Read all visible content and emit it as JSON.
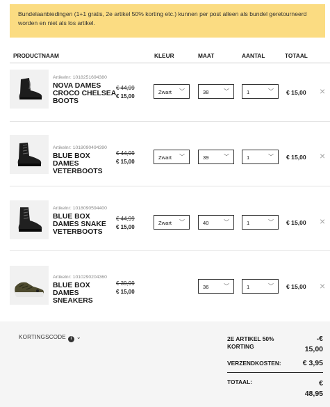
{
  "notice": {
    "text": "Bundelaanbiedingen (1+1 gratis, 2e artikel 50% korting etc.) kunnen per post alleen als bundel geretourneerd worden en niet als los artikel."
  },
  "table_headers": {
    "product": "PRODUCTNAAM",
    "color": "KLEUR",
    "size": "MAAT",
    "quantity": "AANTAL",
    "total": "TOTAAL"
  },
  "items": [
    {
      "artnr": "Artikelnr: 1018251694380",
      "name": "NOVA DAMES CROCO CHELSEA BOOTS",
      "old_price": "€ 44,99",
      "new_price": "€ 15,00",
      "color": "Zwart",
      "size": "38",
      "qty": "1",
      "total": "€ 15,00",
      "image_icon": "chelsea-boot-icon"
    },
    {
      "artnr": "Artikelnr: 1018090494390",
      "name": "BLUE BOX DAMES VETERBOOTS",
      "old_price": "€ 44,99",
      "new_price": "€ 15,00",
      "color": "Zwart",
      "size": "39",
      "qty": "1",
      "total": "€ 15,00",
      "image_icon": "lace-boot-icon"
    },
    {
      "artnr": "Artikelnr: 1018090594400",
      "name": "BLUE BOX DAMES SNAKE VETERBOOTS",
      "old_price": "€ 44,99",
      "new_price": "€ 15,00",
      "color": "Zwart",
      "size": "40",
      "qty": "1",
      "total": "€ 15,00",
      "image_icon": "lace-boot-icon"
    },
    {
      "artnr": "Artikelnr: 1010290204360",
      "name": "BLUE BOX DAMES SNEAKERS",
      "old_price": "€ 39,99",
      "new_price": "€ 15,00",
      "color": "",
      "size": "36",
      "qty": "1",
      "total": "€ 15,00",
      "image_icon": "sneaker-icon"
    }
  ],
  "remove_icon": "×",
  "coupon": {
    "label": "KORTINGSCODE"
  },
  "summary": {
    "discount_label": "2E ARTIKEL 50% KORTING",
    "discount_sign": "-€",
    "discount_value": "15,00",
    "shipping_label": "VERZENDKOSTEN:",
    "shipping_value": "€ 3,95",
    "total_label": "TOTAAL:",
    "total_sign": "€",
    "total_value": "48,95"
  },
  "colors": {
    "notice_bg": "#fbdc82",
    "summary_bg": "#f5f5f5"
  }
}
